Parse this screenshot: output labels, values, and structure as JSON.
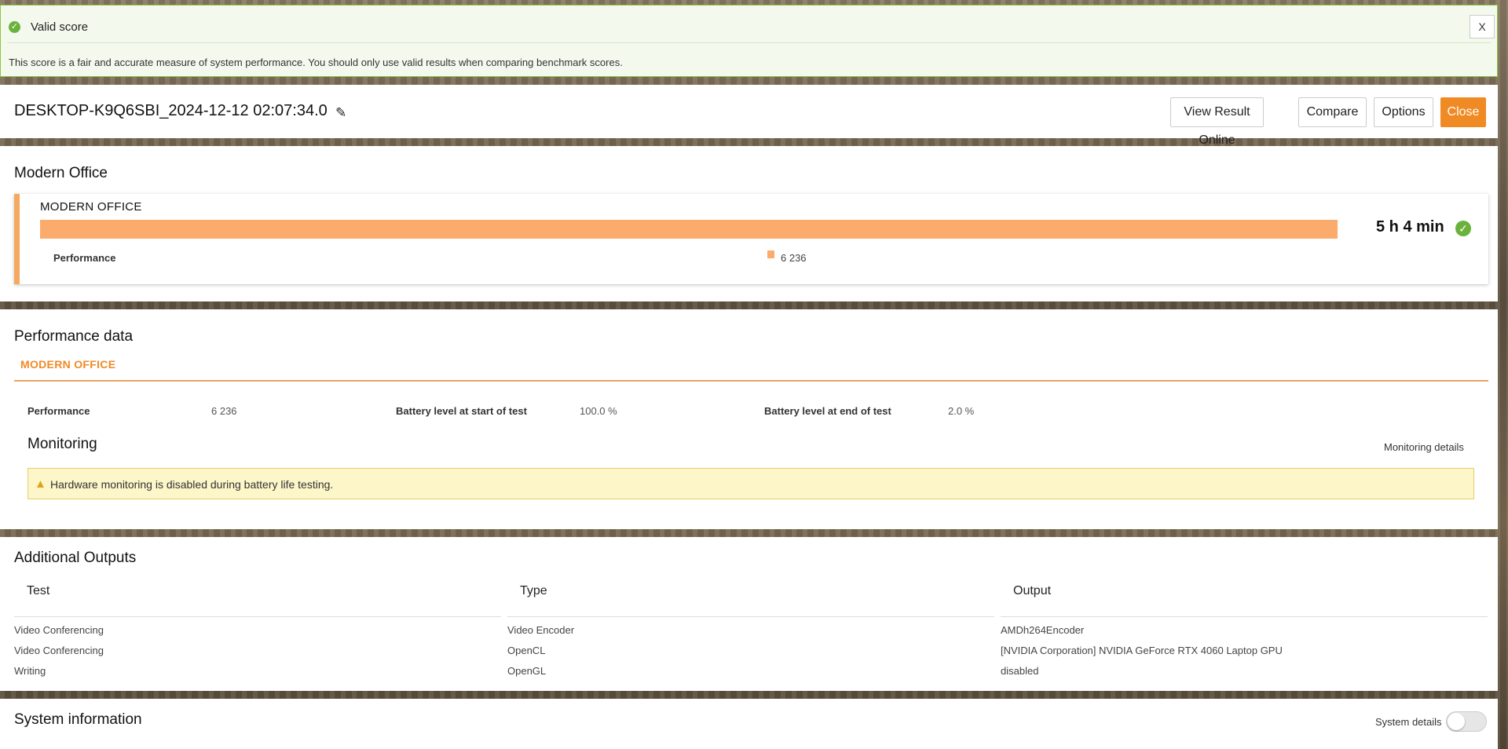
{
  "banner": {
    "title": "Valid score",
    "description": "This score is a fair and accurate measure of system performance. You should only use valid results when comparing benchmark scores.",
    "close_label": "X",
    "status_color": "#6ab23c"
  },
  "header": {
    "result_name": "DESKTOP-K9Q6SBI_2024-12-12 02:07:34.0",
    "buttons": {
      "view_online": "View Result Online",
      "compare": "Compare",
      "options": "Options",
      "close": "Close"
    },
    "accent_color": "#f08a24"
  },
  "score": {
    "section_title": "Modern Office",
    "card_label": "MODERN OFFICE",
    "metric_label": "Performance",
    "metric_value": "6 236",
    "battery_time": "5 h 4 min",
    "bar_color": "#fbab6b"
  },
  "performance_data": {
    "section_title": "Performance data",
    "tab_label": "MODERN OFFICE",
    "metrics": [
      {
        "label": "Performance",
        "value": "6 236"
      },
      {
        "label": "Battery level at start of test",
        "value": "100.0 %"
      },
      {
        "label": "Battery level at end of test",
        "value": "2.0 %"
      }
    ],
    "monitoring": {
      "title": "Monitoring",
      "details_link": "Monitoring details",
      "warning": "Hardware monitoring is disabled during battery life testing."
    }
  },
  "additional_outputs": {
    "section_title": "Additional Outputs",
    "columns": [
      "Test",
      "Type",
      "Output"
    ],
    "rows": [
      [
        "Video Conferencing",
        "Video Encoder",
        "AMDh264Encoder"
      ],
      [
        "Video Conferencing",
        "OpenCL",
        "[NVIDIA Corporation] NVIDIA GeForce RTX 4060 Laptop GPU"
      ],
      [
        "Writing",
        "OpenGL",
        "disabled"
      ]
    ]
  },
  "system_information": {
    "section_title": "System information",
    "details_label": "System details",
    "details_toggle_on": false
  }
}
